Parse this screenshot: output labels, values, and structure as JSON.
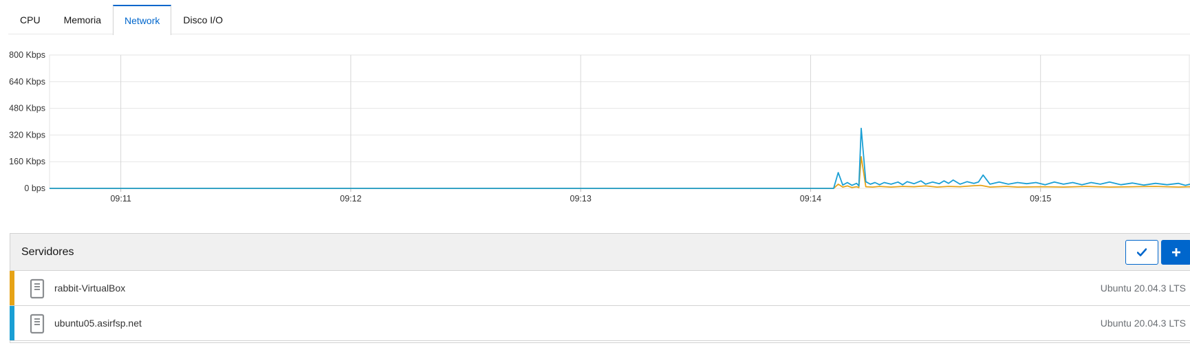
{
  "tabs": [
    {
      "label": "CPU",
      "active": false
    },
    {
      "label": "Memoria",
      "active": false
    },
    {
      "label": "Network",
      "active": true
    },
    {
      "label": "Disco I/O",
      "active": false
    }
  ],
  "colors": {
    "accent": "#0066cc",
    "series_a": "#e6a317",
    "series_b": "#1a9fd4",
    "grid": "#d8d8d8"
  },
  "chart_data": {
    "type": "line",
    "ylabel": "",
    "xlabel": "",
    "y_unit": "Kbps",
    "ylim": [
      0,
      800
    ],
    "y_tick_labels": [
      "0 bps",
      "160 Kbps",
      "320 Kbps",
      "480 Kbps",
      "640 Kbps",
      "800 Kbps"
    ],
    "y_tick_values": [
      0,
      160,
      320,
      480,
      640,
      800
    ],
    "x_tick_labels": [
      "09:11",
      "09:12",
      "09:13",
      "09:14",
      "09:15"
    ],
    "x_tick_minutes": [
      11,
      12,
      13,
      14,
      15
    ],
    "xlim_minutes": [
      10.69,
      15.65
    ],
    "grid": true,
    "series": [
      {
        "name": "rabbit-VirtualBox",
        "color": "#e6a317",
        "points": [
          [
            10.69,
            0
          ],
          [
            14.0,
            0
          ],
          [
            14.1,
            0
          ],
          [
            14.12,
            25
          ],
          [
            14.14,
            8
          ],
          [
            14.16,
            15
          ],
          [
            14.18,
            5
          ],
          [
            14.2,
            10
          ],
          [
            14.21,
            5
          ],
          [
            14.22,
            190
          ],
          [
            14.24,
            10
          ],
          [
            14.27,
            8
          ],
          [
            14.3,
            12
          ],
          [
            14.35,
            8
          ],
          [
            14.4,
            12
          ],
          [
            14.45,
            10
          ],
          [
            14.5,
            15
          ],
          [
            14.55,
            8
          ],
          [
            14.6,
            12
          ],
          [
            14.65,
            10
          ],
          [
            14.7,
            15
          ],
          [
            14.74,
            18
          ],
          [
            14.78,
            8
          ],
          [
            14.85,
            12
          ],
          [
            14.9,
            8
          ],
          [
            15.0,
            10
          ],
          [
            15.1,
            8
          ],
          [
            15.2,
            12
          ],
          [
            15.3,
            8
          ],
          [
            15.4,
            10
          ],
          [
            15.5,
            12
          ],
          [
            15.6,
            8
          ],
          [
            15.65,
            10
          ]
        ]
      },
      {
        "name": "ubuntu05.asirfsp.net",
        "color": "#1a9fd4",
        "points": [
          [
            10.69,
            0
          ],
          [
            14.0,
            0
          ],
          [
            14.1,
            0
          ],
          [
            14.12,
            95
          ],
          [
            14.14,
            20
          ],
          [
            14.16,
            35
          ],
          [
            14.18,
            18
          ],
          [
            14.2,
            30
          ],
          [
            14.21,
            15
          ],
          [
            14.22,
            360
          ],
          [
            14.24,
            40
          ],
          [
            14.26,
            25
          ],
          [
            14.28,
            35
          ],
          [
            14.3,
            22
          ],
          [
            14.32,
            35
          ],
          [
            14.35,
            25
          ],
          [
            14.38,
            38
          ],
          [
            14.4,
            22
          ],
          [
            14.42,
            40
          ],
          [
            14.45,
            28
          ],
          [
            14.48,
            45
          ],
          [
            14.5,
            25
          ],
          [
            14.53,
            38
          ],
          [
            14.56,
            28
          ],
          [
            14.58,
            45
          ],
          [
            14.6,
            30
          ],
          [
            14.62,
            50
          ],
          [
            14.65,
            25
          ],
          [
            14.68,
            40
          ],
          [
            14.71,
            30
          ],
          [
            14.73,
            38
          ],
          [
            14.75,
            80
          ],
          [
            14.78,
            25
          ],
          [
            14.82,
            38
          ],
          [
            14.86,
            25
          ],
          [
            14.9,
            35
          ],
          [
            14.94,
            28
          ],
          [
            14.98,
            35
          ],
          [
            15.02,
            22
          ],
          [
            15.06,
            38
          ],
          [
            15.1,
            25
          ],
          [
            15.14,
            35
          ],
          [
            15.18,
            22
          ],
          [
            15.22,
            35
          ],
          [
            15.26,
            25
          ],
          [
            15.3,
            38
          ],
          [
            15.35,
            22
          ],
          [
            15.4,
            32
          ],
          [
            15.45,
            20
          ],
          [
            15.5,
            30
          ],
          [
            15.55,
            22
          ],
          [
            15.6,
            30
          ],
          [
            15.63,
            18
          ],
          [
            15.65,
            25
          ]
        ]
      }
    ]
  },
  "servers_panel": {
    "title": "Servidores",
    "check_icon": "check-icon",
    "plus_icon": "plus-icon",
    "rows": [
      {
        "name": "rabbit-VirtualBox",
        "os": "Ubuntu 20.04.3 LTS",
        "color": "#e6a317",
        "icon": "server-icon"
      },
      {
        "name": "ubuntu05.asirfsp.net",
        "os": "Ubuntu 20.04.3 LTS",
        "color": "#1a9fd4",
        "icon": "server-icon"
      }
    ]
  }
}
